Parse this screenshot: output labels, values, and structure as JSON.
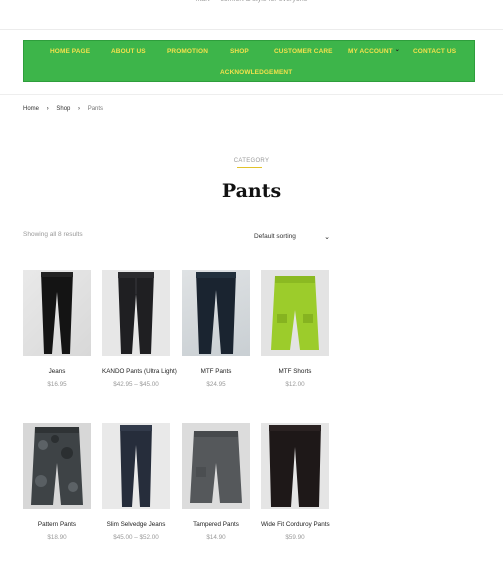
{
  "header": {
    "top_text": "mart — comfort & style for everyone"
  },
  "nav": {
    "items": [
      {
        "label": "HOME PAGE"
      },
      {
        "label": "ABOUT US"
      },
      {
        "label": "PROMOTION"
      },
      {
        "label": "SHOP"
      },
      {
        "label": "CUSTOMER CARE"
      },
      {
        "label": "MY ACCOUNT"
      },
      {
        "label": "CONTACT US"
      },
      {
        "label": "ACKNOWLEDGEMENT"
      }
    ],
    "colors": {
      "background": "#3db54a",
      "text": "#f2e14c"
    }
  },
  "breadcrumb": {
    "home": "Home",
    "shop": "Shop",
    "current": "Pants"
  },
  "category": {
    "label": "CATEGORY",
    "title": "Pants"
  },
  "toolbar": {
    "result_count": "Showing all 8 results",
    "sort_value": "Default sorting"
  },
  "products": [
    {
      "name": "Jeans",
      "price": "$16.95",
      "icon": "black-jeans"
    },
    {
      "name": "KANDO Pants (Ultra Light)",
      "price": "$42.95 – $45.00",
      "icon": "dark-pants"
    },
    {
      "name": "MTF Pants",
      "price": "$24.95",
      "icon": "navy-pants"
    },
    {
      "name": "MTF Shorts",
      "price": "$12.00",
      "icon": "lime-shorts"
    },
    {
      "name": "Pattern Pants",
      "price": "$18.90",
      "icon": "camo-shorts"
    },
    {
      "name": "Slim Selvedge Jeans",
      "price": "$45.00 – $52.00",
      "icon": "navy-jeans"
    },
    {
      "name": "Tampered Pants",
      "price": "$14.90",
      "icon": "grey-shorts"
    },
    {
      "name": "Wide Fit Corduroy Pants",
      "price": "$59.90",
      "icon": "black-corduroy"
    }
  ]
}
